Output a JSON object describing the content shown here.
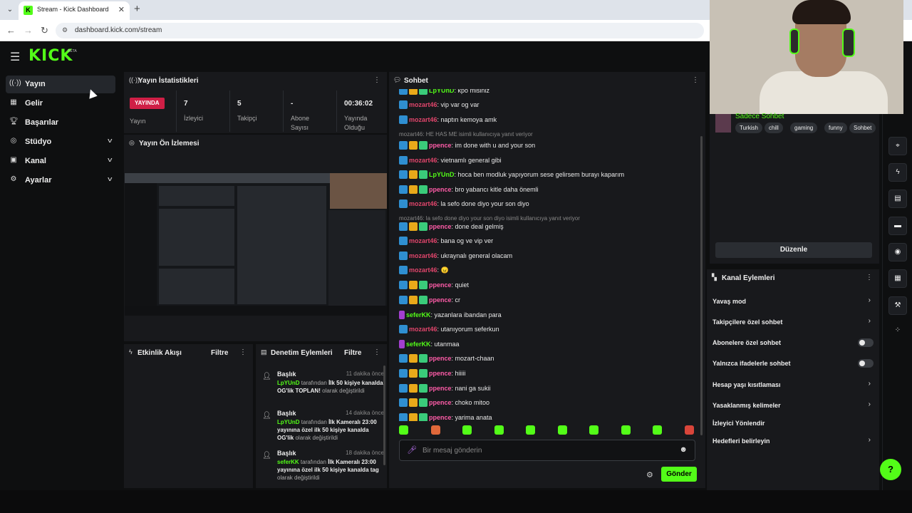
{
  "browser": {
    "tab_title": "Stream - Kick Dashboard",
    "url": "dashboard.kick.com/stream"
  },
  "app": {
    "logo": "KICK",
    "logo_badge": "BETA"
  },
  "sidebar": {
    "items": [
      {
        "label": "Yayın",
        "icon": "broadcast-icon",
        "active": true,
        "expandable": false
      },
      {
        "label": "Gelir",
        "icon": "revenue-icon",
        "active": false,
        "expandable": false
      },
      {
        "label": "Başarılar",
        "icon": "trophy-icon",
        "active": false,
        "expandable": false
      },
      {
        "label": "Stüdyo",
        "icon": "studio-icon",
        "active": false,
        "expandable": true
      },
      {
        "label": "Kanal",
        "icon": "channel-icon",
        "active": false,
        "expandable": true
      },
      {
        "label": "Ayarlar",
        "icon": "gear-icon",
        "active": false,
        "expandable": true
      }
    ]
  },
  "stats": {
    "title": "Yayın İstatistikleri",
    "live_badge": "YAYINDA",
    "live_label": "Yayın",
    "cells": [
      {
        "value": "7",
        "label": "İzleyici"
      },
      {
        "value": "5",
        "label": "Takipçi"
      },
      {
        "value": "-",
        "label": "Abone Sayısı"
      },
      {
        "value": "00:36:02",
        "label": "Yayında Olduğu"
      }
    ]
  },
  "preview": {
    "title": "Yayın Ön İzlemesi"
  },
  "events": {
    "title": "Etkinlik Akışı",
    "filter": "Filtre"
  },
  "moderation": {
    "title": "Denetim Eylemleri",
    "filter": "Filtre",
    "items": [
      {
        "title": "Başlık",
        "time": "11 dakika önce",
        "user": "LpYUnD",
        "pre": "tarafından",
        "value": "İlk 50 kişiye kanalda OG'lik TOPLAN!",
        "post": "olarak değiştirildi"
      },
      {
        "title": "Başlık",
        "time": "14 dakika önce",
        "user": "LpYUnD",
        "pre": "tarafından",
        "value": "İlk Kameralı 23:00 yayınına özel ilk 50 kişiye kanalda OG'lik",
        "post": "olarak değiştirildi"
      },
      {
        "title": "Başlık",
        "time": "18 dakika önce",
        "user": "seferKK",
        "pre": "tarafından",
        "value": "İlk Kameralı 23:00 yayınına özel ilk 50 kişiye kanalda tag",
        "post": "olarak değiştirildi"
      }
    ]
  },
  "chat": {
    "title": "Sohbet",
    "messages": [
      {
        "badges": [
          "mod",
          "crown",
          "sub"
        ],
        "nick": "LpYUnD",
        "color": "#53fc18",
        "text": "kpo misiniz"
      },
      {
        "badges": [
          "mod"
        ],
        "nick": "mozart46",
        "color": "#e0456b",
        "text": "vip var og var"
      },
      {
        "badges": [
          "mod"
        ],
        "nick": "mozart46",
        "color": "#e0456b",
        "text": "naptın kemoya amk"
      },
      {
        "reply": "mozart46: HE HAS ME isimli kullanıcıya yanıt veriyor"
      },
      {
        "badges": [
          "mod",
          "crown",
          "sub"
        ],
        "nick": "ppence",
        "color": "#ff5ca8",
        "text": "im done with u and your son"
      },
      {
        "badges": [
          "mod"
        ],
        "nick": "mozart46",
        "color": "#e0456b",
        "text": "vietnamlı general gibi"
      },
      {
        "badges": [
          "mod",
          "crown",
          "sub"
        ],
        "nick": "LpYUnD",
        "color": "#53fc18",
        "text": "hoca ben modluk yapıyorum sese gelirsem burayı kaparım"
      },
      {
        "badges": [
          "mod",
          "crown",
          "sub"
        ],
        "nick": "ppence",
        "color": "#ff5ca8",
        "text": "bro yabancı kitle daha önemli"
      },
      {
        "badges": [
          "mod"
        ],
        "nick": "mozart46",
        "color": "#e0456b",
        "text": "la sefo done diyo your son diyo"
      },
      {
        "reply": "mozart46: la sefo done diyo your son diyo isimli kullanıcıya yanıt veriyor"
      },
      {
        "badges": [
          "mod",
          "crown",
          "sub"
        ],
        "nick": "ppence",
        "color": "#ff5ca8",
        "text": "done deal gelmiş"
      },
      {
        "badges": [
          "mod"
        ],
        "nick": "mozart46",
        "color": "#e0456b",
        "text": "bana og ve vip ver"
      },
      {
        "badges": [
          "mod"
        ],
        "nick": "mozart46",
        "color": "#e0456b",
        "text": "ukraynalı general olacam"
      },
      {
        "badges": [
          "mod"
        ],
        "nick": "mozart46",
        "color": "#e0456b",
        "text": "😠"
      },
      {
        "badges": [
          "mod",
          "crown",
          "sub"
        ],
        "nick": "ppence",
        "color": "#ff5ca8",
        "text": "quiet"
      },
      {
        "badges": [
          "mod",
          "crown",
          "sub"
        ],
        "nick": "ppence",
        "color": "#ff5ca8",
        "text": "cr"
      },
      {
        "badges": [
          "mic"
        ],
        "nick": "seferKK",
        "color": "#53fc18",
        "text": "yazanlara ibandan para"
      },
      {
        "badges": [
          "mod"
        ],
        "nick": "mozart46",
        "color": "#e0456b",
        "text": "utanıyorum seferkun"
      },
      {
        "badges": [
          "mic"
        ],
        "nick": "seferKK",
        "color": "#53fc18",
        "text": "utanmaa"
      },
      {
        "badges": [
          "mod",
          "crown",
          "sub"
        ],
        "nick": "ppence",
        "color": "#ff5ca8",
        "text": "mozart-chaan"
      },
      {
        "badges": [
          "mod",
          "crown",
          "sub"
        ],
        "nick": "ppence",
        "color": "#ff5ca8",
        "text": "hiiiii"
      },
      {
        "badges": [
          "mod",
          "crown",
          "sub"
        ],
        "nick": "ppence",
        "color": "#ff5ca8",
        "text": "nani ga sukii"
      },
      {
        "badges": [
          "mod",
          "crown",
          "sub"
        ],
        "nick": "ppence",
        "color": "#ff5ca8",
        "text": "choko mitoo"
      },
      {
        "badges": [
          "mod",
          "crown",
          "sub"
        ],
        "nick": "ppence",
        "color": "#ff5ca8",
        "text": "yarima anata"
      }
    ],
    "input_placeholder": "Bir mesaj gönderin",
    "send_label": "Gönder"
  },
  "stream_info": {
    "title": "Sadece Sohbet",
    "tags": [
      "Turkish",
      "chill",
      "gaming",
      "funny",
      "Sohbet"
    ],
    "edit_label": "Düzenle"
  },
  "channel_actions": {
    "title": "Kanal Eylemleri",
    "rows": [
      {
        "label": "Yavaş mod",
        "kind": "chevron"
      },
      {
        "label": "Takipçilere özel sohbet",
        "kind": "chevron"
      },
      {
        "label": "Abonelere özel sohbet",
        "kind": "toggle"
      },
      {
        "label": "Yalnızca ifadelerle sohbet",
        "kind": "toggle"
      },
      {
        "label": "Hesap yaşı kısıtlaması",
        "kind": "chevron"
      },
      {
        "label": "Yasaklanmış kelimeler",
        "kind": "chevron"
      },
      {
        "label": "İzleyici Yönlendir",
        "kind": "none"
      },
      {
        "label": "Hedefleri belirleyin",
        "kind": "chevron"
      }
    ]
  },
  "tool_rail": [
    "camera-icon",
    "bolt-icon",
    "document-icon",
    "chat-bubble-icon",
    "broadcast-icon",
    "layout-icon",
    "wrench-icon",
    "dots-icon"
  ],
  "colors": {
    "brand": "#53fc18",
    "live": "#d01f46",
    "panel": "#18191c"
  }
}
